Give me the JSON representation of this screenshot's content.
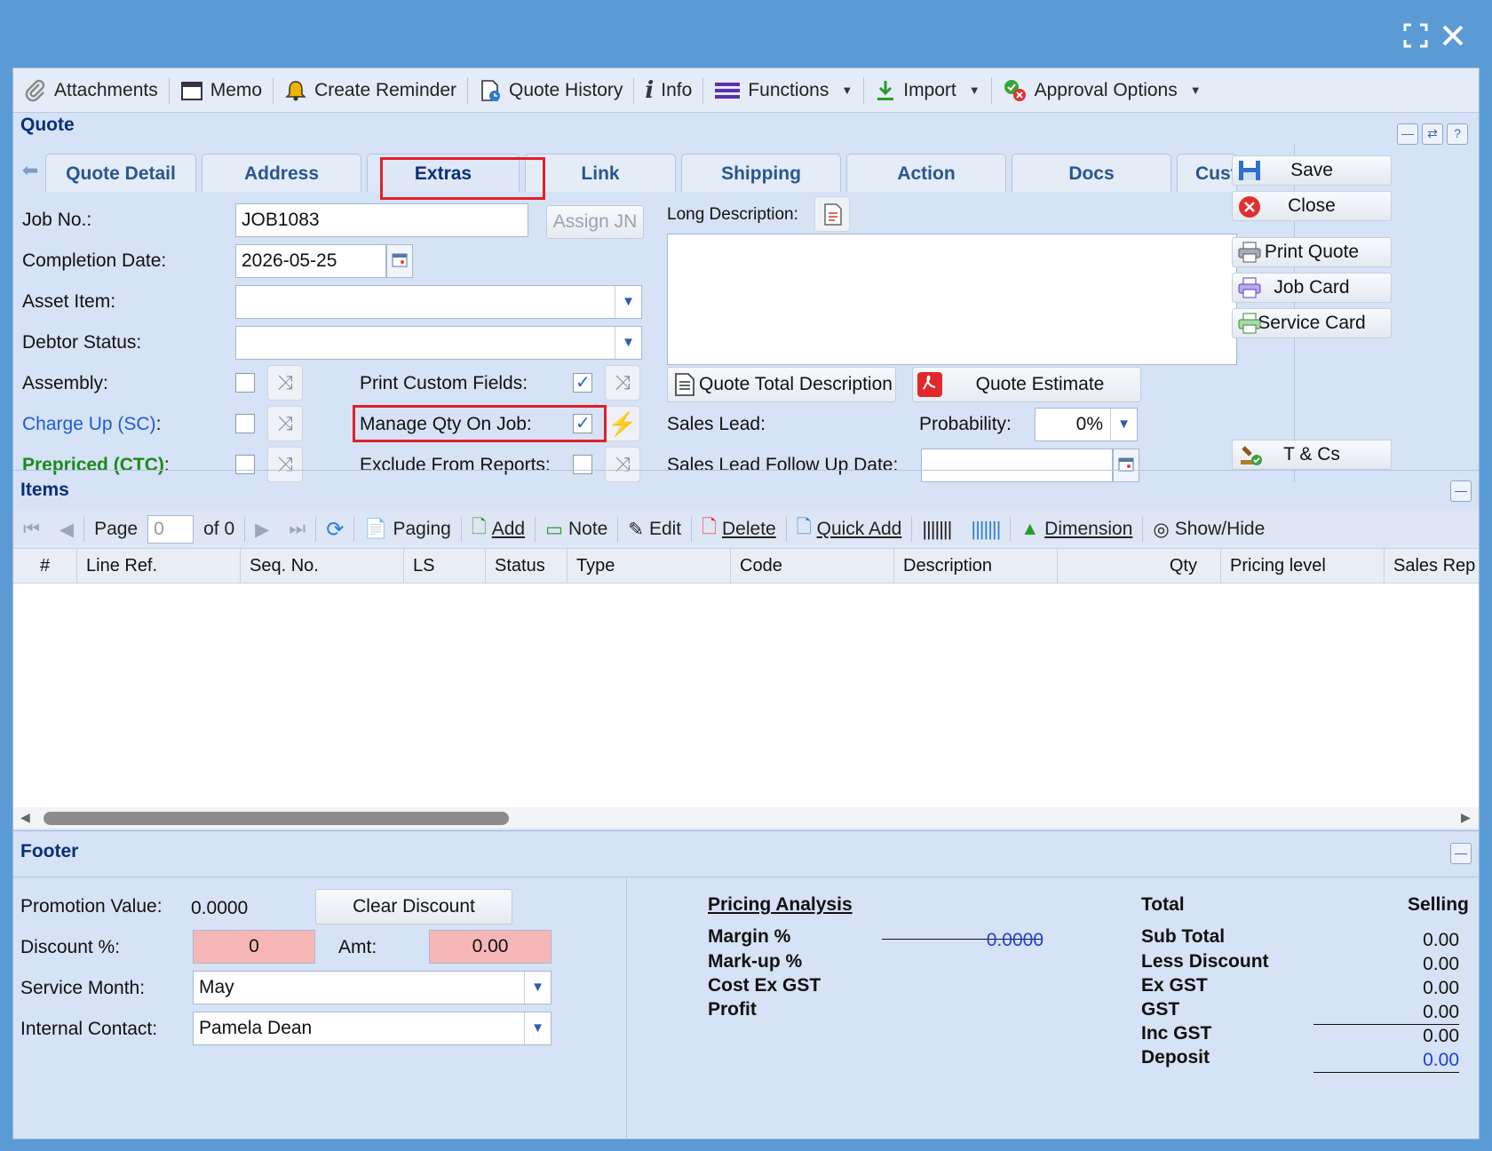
{
  "window": {
    "maximize_icon": "expand-icon",
    "close_icon": "close-icon"
  },
  "toolbar": {
    "attachments": "Attachments",
    "memo": "Memo",
    "create_reminder": "Create Reminder",
    "quote_history": "Quote History",
    "info": "Info",
    "functions": "Functions",
    "import": "Import",
    "approval_options": "Approval Options"
  },
  "quote": {
    "title": "Quote"
  },
  "tabs": [
    "Quote Detail",
    "Address",
    "Extras",
    "Link",
    "Shipping",
    "Action",
    "Docs",
    "Cust"
  ],
  "active_tab": "Extras",
  "side": {
    "save": "Save",
    "close": "Close",
    "print_quote": "Print Quote",
    "job_card": "Job Card",
    "service_card": "Service Card",
    "tcs": "T & Cs"
  },
  "form": {
    "job_no_label": "Job No.:",
    "job_no": "JOB1083",
    "assign_jn": "Assign JN",
    "completion_date_label": "Completion Date:",
    "completion_date": "2026-05-25",
    "asset_item_label": "Asset Item:",
    "asset_item": "",
    "debtor_status_label": "Debtor Status:",
    "debtor_status": "",
    "assembly_label": "Assembly:",
    "assembly": false,
    "charge_up_label": "Charge Up (SC)",
    "charge_up_colon": ":",
    "charge_up": false,
    "prepriced_label": "Prepriced (CTC)",
    "prepriced_colon": ":",
    "prepriced": false,
    "print_custom_label": "Print Custom Fields:",
    "print_custom": true,
    "manage_qty_label": "Manage Qty On Job:",
    "manage_qty": true,
    "exclude_reports_label": "Exclude From Reports:",
    "exclude_reports": false,
    "long_desc_label": "Long Description:",
    "long_desc": "",
    "quote_total_desc": "Quote Total Description",
    "quote_estimate": "Quote Estimate",
    "sales_lead_label": "Sales Lead:",
    "probability_label": "Probability:",
    "probability": "0%",
    "followup_label": "Sales Lead Follow Up Date:",
    "followup": ""
  },
  "items": {
    "title": "Items",
    "page_label": "Page",
    "page": "0",
    "of": "of 0",
    "paging": "Paging",
    "add": "Add",
    "note": "Note",
    "edit": "Edit",
    "delete": "Delete",
    "quick_add": "Quick Add",
    "dimension": "Dimension",
    "show_hide": "Show/Hide",
    "columns": [
      "#",
      "Line Ref.",
      "Seq. No.",
      "LS",
      "Status",
      "Type",
      "Code",
      "Description",
      "Qty",
      "Pricing level",
      "Sales Rep"
    ]
  },
  "footer": {
    "title": "Footer",
    "promotion_label": "Promotion Value:",
    "promotion": "0.0000",
    "clear_discount": "Clear Discount",
    "discount_label": "Discount %:",
    "discount": "0",
    "amt_label": "Amt:",
    "amt": "0.00",
    "service_month_label": "Service Month:",
    "service_month": "May",
    "internal_contact_label": "Internal Contact:",
    "internal_contact": "Pamela Dean",
    "pricing_title": "Pricing Analysis",
    "margin": "Margin %",
    "markup": "Mark-up %",
    "cost": "Cost Ex GST",
    "profit": "Profit",
    "margin_value": "0.0000",
    "total_title": "Total",
    "selling": "Selling",
    "sub_total": "Sub Total",
    "less_discount": "Less Discount",
    "ex_gst": "Ex GST",
    "gst": "GST",
    "inc_gst": "Inc GST",
    "deposit": "Deposit",
    "sub_total_v": "0.00",
    "less_discount_v": "0.00",
    "ex_gst_v": "0.00",
    "gst_v": "0.00",
    "inc_gst_v": "0.00",
    "deposit_v": "0.00"
  },
  "colors": {
    "accent": "#0b2e78",
    "highlight": "#e0202a",
    "link_blue": "#1f5bd6",
    "green": "#1a8a1a"
  }
}
